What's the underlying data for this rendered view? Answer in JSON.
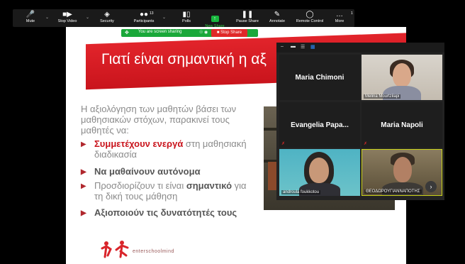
{
  "toolbar": {
    "items": [
      {
        "label": "Mute",
        "icon": "microphone-icon"
      },
      {
        "label": "Stop Video",
        "icon": "video-camera-icon"
      },
      {
        "label": "Security",
        "icon": "shield-icon"
      },
      {
        "label": "Participants",
        "icon": "participants-icon",
        "count": "13"
      },
      {
        "label": "Polls",
        "icon": "polls-icon"
      },
      {
        "label": "New Share",
        "icon": "share-arrow-icon"
      },
      {
        "label": "Pause Share",
        "icon": "pause-icon"
      },
      {
        "label": "Annotate",
        "icon": "pencil-icon"
      },
      {
        "label": "Remote Control",
        "icon": "mouse-icon"
      },
      {
        "label": "More",
        "icon": "more-dots-icon",
        "badge": "1"
      }
    ]
  },
  "sharing_bar": {
    "text": "You are screen sharing",
    "stop_label": "Stop Share",
    "color": "#1aa83a"
  },
  "slide": {
    "title": "Γιατί είναι σημαντική η αξ",
    "intro": "Η αξιολόγηση των μαθητών βάσει των μαθησιακών στόχων, παρακινεί τους μαθητές να:",
    "bullets": [
      {
        "bold": "Συμμετέχουν ενεργά",
        "rest": " στη μαθησιακή διαδικασία"
      },
      {
        "text": "Να μαθαίνουν αυτόνομα"
      },
      {
        "pre": "Προσδιορίζουν τι είναι ",
        "bold": "σημαντικό",
        "rest": " για τη δική τους μάθηση"
      },
      {
        "text": "Αξιοποιούν τις δυνατότητές τους"
      }
    ],
    "logo_text": "enterschoolmind",
    "accent_color": "#c9141c"
  },
  "gallery": {
    "tiles": [
      {
        "name": "Maria Chimoni",
        "type": "name"
      },
      {
        "name": "Melina Mourtzilapi",
        "type": "video"
      },
      {
        "name": "Evangelia Papa...",
        "type": "name"
      },
      {
        "name": "Maria Napoli",
        "type": "name"
      },
      {
        "name": "androula foukkotou",
        "type": "video"
      },
      {
        "name": "ΘΕΟΔΩΡΟΥΓΙΑΝΝΑΠΟΤΗΣ",
        "type": "video"
      }
    ]
  }
}
